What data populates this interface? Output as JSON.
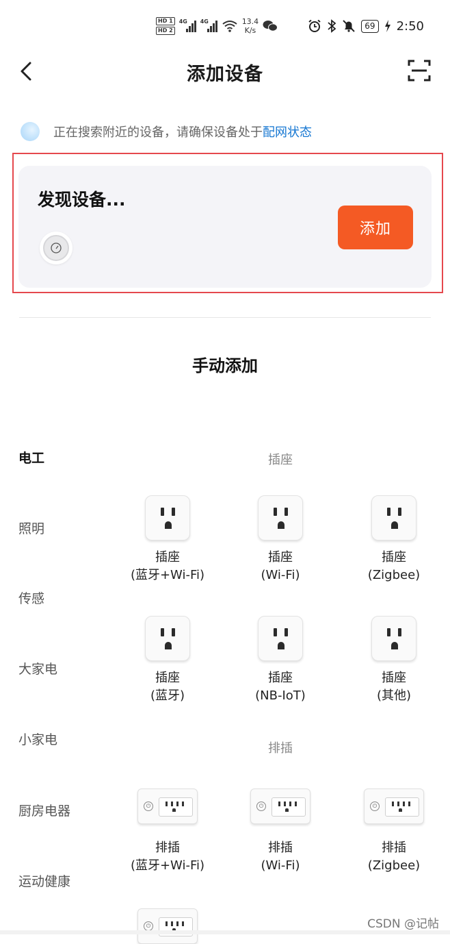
{
  "status_bar": {
    "hd1": "HD 1",
    "hd2": "HD 2",
    "signal1": "4G",
    "signal2": "4G",
    "speed_value": "13.4",
    "speed_unit": "K/s",
    "battery": "69",
    "time": "2:50",
    "icons": [
      "wifi-icon",
      "wechat-icon",
      "alarm-icon",
      "bluetooth-icon",
      "mute-icon",
      "charging-icon"
    ]
  },
  "header": {
    "title": "添加设备",
    "back_icon": "chevron-left-icon",
    "scan_icon": "scan-icon"
  },
  "search_hint": {
    "text": "正在搜索附近的设备，请确保设备处于",
    "link": "配网状态"
  },
  "discovered": {
    "title": "发现设备...",
    "add_label": "添加",
    "accent": "#f45a24"
  },
  "manual": {
    "title": "手动添加"
  },
  "categories": [
    "电工",
    "照明",
    "传感",
    "大家电",
    "小家电",
    "厨房电器",
    "运动健康"
  ],
  "sections": [
    {
      "title": "插座",
      "items": [
        {
          "name": "插座",
          "sub": "(蓝牙+Wi-Fi)"
        },
        {
          "name": "插座",
          "sub": "(Wi-Fi)"
        },
        {
          "name": "插座",
          "sub": "(Zigbee)"
        },
        {
          "name": "插座",
          "sub": "(蓝牙)"
        },
        {
          "name": "插座",
          "sub": "(NB-IoT)"
        },
        {
          "name": "插座",
          "sub": "(其他)"
        }
      ]
    },
    {
      "title": "排插",
      "items": [
        {
          "name": "排插",
          "sub": "(蓝牙+Wi-Fi)"
        },
        {
          "name": "排插",
          "sub": "(Wi-Fi)"
        },
        {
          "name": "排插",
          "sub": "(Zigbee)"
        }
      ]
    }
  ],
  "watermark": "CSDN @记帖"
}
